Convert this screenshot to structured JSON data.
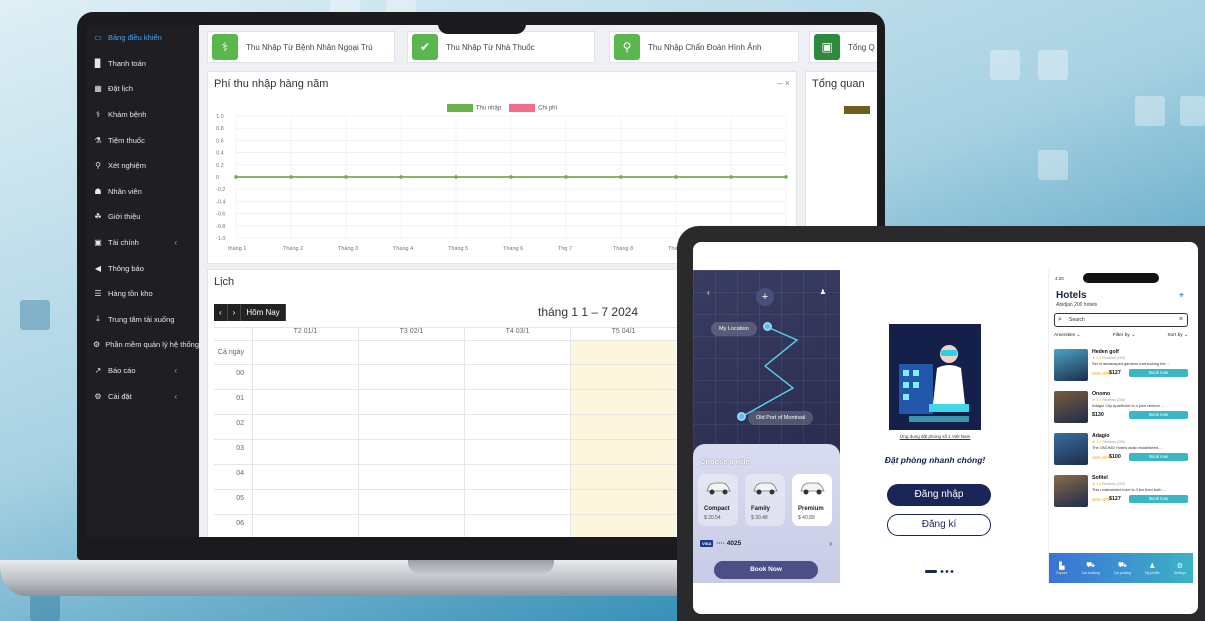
{
  "sidebar": {
    "items": [
      {
        "label": "Bảng điều khiển",
        "icon": "monitor-icon",
        "glyph": "▭",
        "active": true
      },
      {
        "label": "Thanh toán",
        "icon": "document-icon",
        "glyph": "▉"
      },
      {
        "label": "Đặt lịch",
        "icon": "calendar-icon",
        "glyph": "▦"
      },
      {
        "label": "Khám bệnh",
        "icon": "stethoscope-icon",
        "glyph": "⚕"
      },
      {
        "label": "Tiệm thuốc",
        "icon": "mortar-icon",
        "glyph": "⚗"
      },
      {
        "label": "Xét nghiệm",
        "icon": "microscope-icon",
        "glyph": "⚲"
      },
      {
        "label": "Nhân viên",
        "icon": "staff-icon",
        "glyph": "☗"
      },
      {
        "label": "Giới thiệu",
        "icon": "handshake-icon",
        "glyph": "☘"
      },
      {
        "label": "Tài chính",
        "icon": "money-icon",
        "glyph": "▣",
        "caret": "‹"
      },
      {
        "label": "Thông báo",
        "icon": "megaphone-icon",
        "glyph": "◀"
      },
      {
        "label": "Hàng tồn kho",
        "icon": "inventory-icon",
        "glyph": "☰"
      },
      {
        "label": "Trung tâm tải xuống",
        "icon": "download-icon",
        "glyph": "⤓"
      },
      {
        "label": "Phần mềm quản lý hệ thống",
        "icon": "software-icon",
        "glyph": "⚙"
      },
      {
        "label": "Báo cáo",
        "icon": "chart-icon",
        "glyph": "↗",
        "caret": "‹"
      },
      {
        "label": "Cài đặt",
        "icon": "cogs-icon",
        "glyph": "⚙",
        "caret": "‹"
      }
    ]
  },
  "stats": [
    {
      "label": "Thu Nhập Từ Bệnh Nhân Ngoại Trú",
      "icon": "stethoscope-icon",
      "glyph": "⚕"
    },
    {
      "label": "Thu Nhập Từ Nhà Thuốc",
      "icon": "mortar-icon",
      "glyph": "✔"
    },
    {
      "label": "Thu Nhập Chẩn Đoán Hình Ảnh",
      "icon": "microscope-icon",
      "glyph": "⚲"
    },
    {
      "label": "Tổng Q",
      "icon": "money-icon",
      "glyph": "▣"
    }
  ],
  "income_panel": {
    "title": "Phí thu nhập hàng năm",
    "controls": "–  ×"
  },
  "chart_data": {
    "type": "line",
    "categories": [
      "tháng 1",
      "Tháng 2",
      "Tháng 3",
      "Tháng 4",
      "Tháng 5",
      "Tháng 6",
      "Thg 7",
      "Tháng 8",
      "Tháng 9",
      "Thán"
    ],
    "series": [
      {
        "name": "Thu nhập",
        "color": "#6ab04c",
        "values": [
          0,
          0,
          0,
          0,
          0,
          0,
          0,
          0,
          0,
          0,
          0
        ]
      },
      {
        "name": "Chi phí",
        "color": "#f0708a",
        "values": [
          0,
          0,
          0,
          0,
          0,
          0,
          0,
          0,
          0,
          0,
          0
        ]
      }
    ],
    "yticks": [
      "1.0",
      "0.8",
      "0.6",
      "0.4",
      "0.2",
      "0",
      "-0.2",
      "-0.4",
      "-0.6",
      "-0.8",
      "-1.0"
    ],
    "ylim": [
      -1,
      1
    ],
    "grid": true,
    "legend": "top-center"
  },
  "overview_panel": {
    "title": "Tổng quan"
  },
  "calendar": {
    "title": "Lịch",
    "prev": "‹",
    "next": "›",
    "today": "Hôm Nay",
    "range": "tháng 1 1 – 7 2024",
    "days": [
      "T2 01/1",
      "T3 02/1",
      "T4 03/1",
      "T5 04/1"
    ],
    "allday": "Cả ngày",
    "hours": [
      "00",
      "01",
      "02",
      "03",
      "04",
      "05",
      "06"
    ]
  },
  "ride_app": {
    "my_location": "My Location",
    "destination": "Old Port of Montreal",
    "plus": "+",
    "back": "‹",
    "choose": "Choose a ride",
    "options": [
      {
        "name": "Compact",
        "price": "$ 20.54"
      },
      {
        "name": "Family",
        "price": "$ 30.48"
      },
      {
        "name": "Premium",
        "price": "$ 40.89",
        "selected": true
      }
    ],
    "visa_badge": "VISA",
    "card": "···· 4025",
    "book": "Book Now"
  },
  "login_app": {
    "caption": "Ứng dụng đặt phòng số 1 Việt Nam",
    "heading": "Đặt phòng nhanh chóng!",
    "login": "Đăng nhập",
    "signup": "Đăng kí"
  },
  "hotels_app": {
    "time": "4:20",
    "title": "Hotels",
    "subtitle": "Abidjan 200 hotels",
    "search": "Search",
    "filters": [
      "Amenities ⌄",
      "Filter by ⌄",
      "Sort by ⌄"
    ],
    "items": [
      {
        "name": "Heden golf",
        "rating": "★ 3.4",
        "reviews": "Reviews (200)",
        "desc": "Set in landscaped gardens overlooking the ...",
        "off": "25% OFF",
        "price": "$127",
        "book": "Book now",
        "color": "#4aa4c9"
      },
      {
        "name": "Onomo",
        "rating": "★ 3.4",
        "reviews": "Reviews (200)",
        "desc": "Adagio City Aparthotel is a joint venture ...",
        "off": "",
        "price": "$130",
        "book": "Book now",
        "color": "#7a5c3e"
      },
      {
        "name": "Adagio",
        "rating": "★ 3.4",
        "reviews": "Reviews (200)",
        "desc": "The ONOMO Hotels chain established ...",
        "off": "15% OFF",
        "price": "$100",
        "book": "Book now",
        "color": "#3c6e9e"
      },
      {
        "name": "Sofitel",
        "rating": "★ 3.4",
        "reviews": "Reviews (200)",
        "desc": "This understated hotel is 3 km from both ...",
        "off": "25% OFF",
        "price": "$127",
        "book": "Book now",
        "color": "#8b6a47"
      }
    ],
    "tabs": [
      {
        "label": "Explore",
        "glyph": "▙",
        "active": true
      },
      {
        "label": "Car booking",
        "glyph": "⛟"
      },
      {
        "label": "Car pooling",
        "glyph": "⛟"
      },
      {
        "label": "My profile",
        "glyph": "♟"
      },
      {
        "label": "Settings",
        "glyph": "⚙"
      }
    ]
  }
}
